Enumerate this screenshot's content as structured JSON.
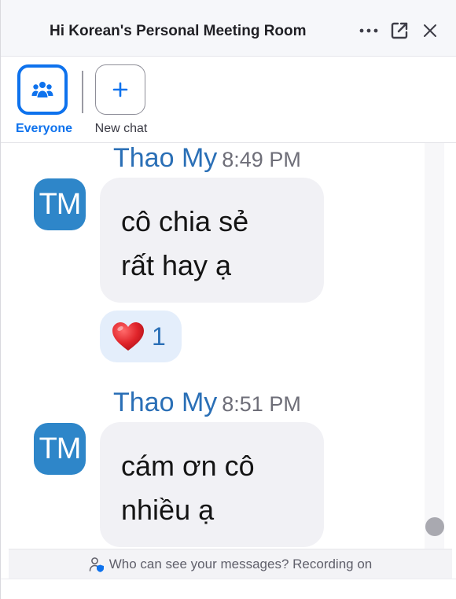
{
  "header": {
    "title": "Hi Korean's Personal Meeting Room",
    "more_icon": "more-horizontal-icon",
    "popout_icon": "pop-out-icon",
    "close_icon": "close-icon"
  },
  "recipients": {
    "everyone": {
      "label": "Everyone",
      "icon": "people-group-icon",
      "selected": true
    },
    "new_chat": {
      "label": "New chat",
      "icon": "plus-icon"
    }
  },
  "messages": [
    {
      "sender": "Thao My",
      "time": "8:49 PM",
      "avatar_initials": "TM",
      "lines": [
        "cô chia sẻ",
        "rất hay ạ"
      ],
      "reaction": {
        "emoji": "heart-icon",
        "count": "1"
      }
    },
    {
      "sender": "Thao My",
      "time": "8:51 PM",
      "avatar_initials": "TM",
      "lines": [
        "cám ơn cô",
        "nhiều ạ"
      ]
    }
  ],
  "footer": {
    "text": "Who can see your messages? Recording on",
    "icon": "person-shield-icon"
  },
  "colors": {
    "accent": "#0e72ed",
    "sender_name": "#2a6fb6",
    "avatar_bg": "#2e86c9",
    "bubble_bg": "#f1f1f5",
    "reaction_bg": "#e4eefb",
    "heart": "#e0242a"
  }
}
